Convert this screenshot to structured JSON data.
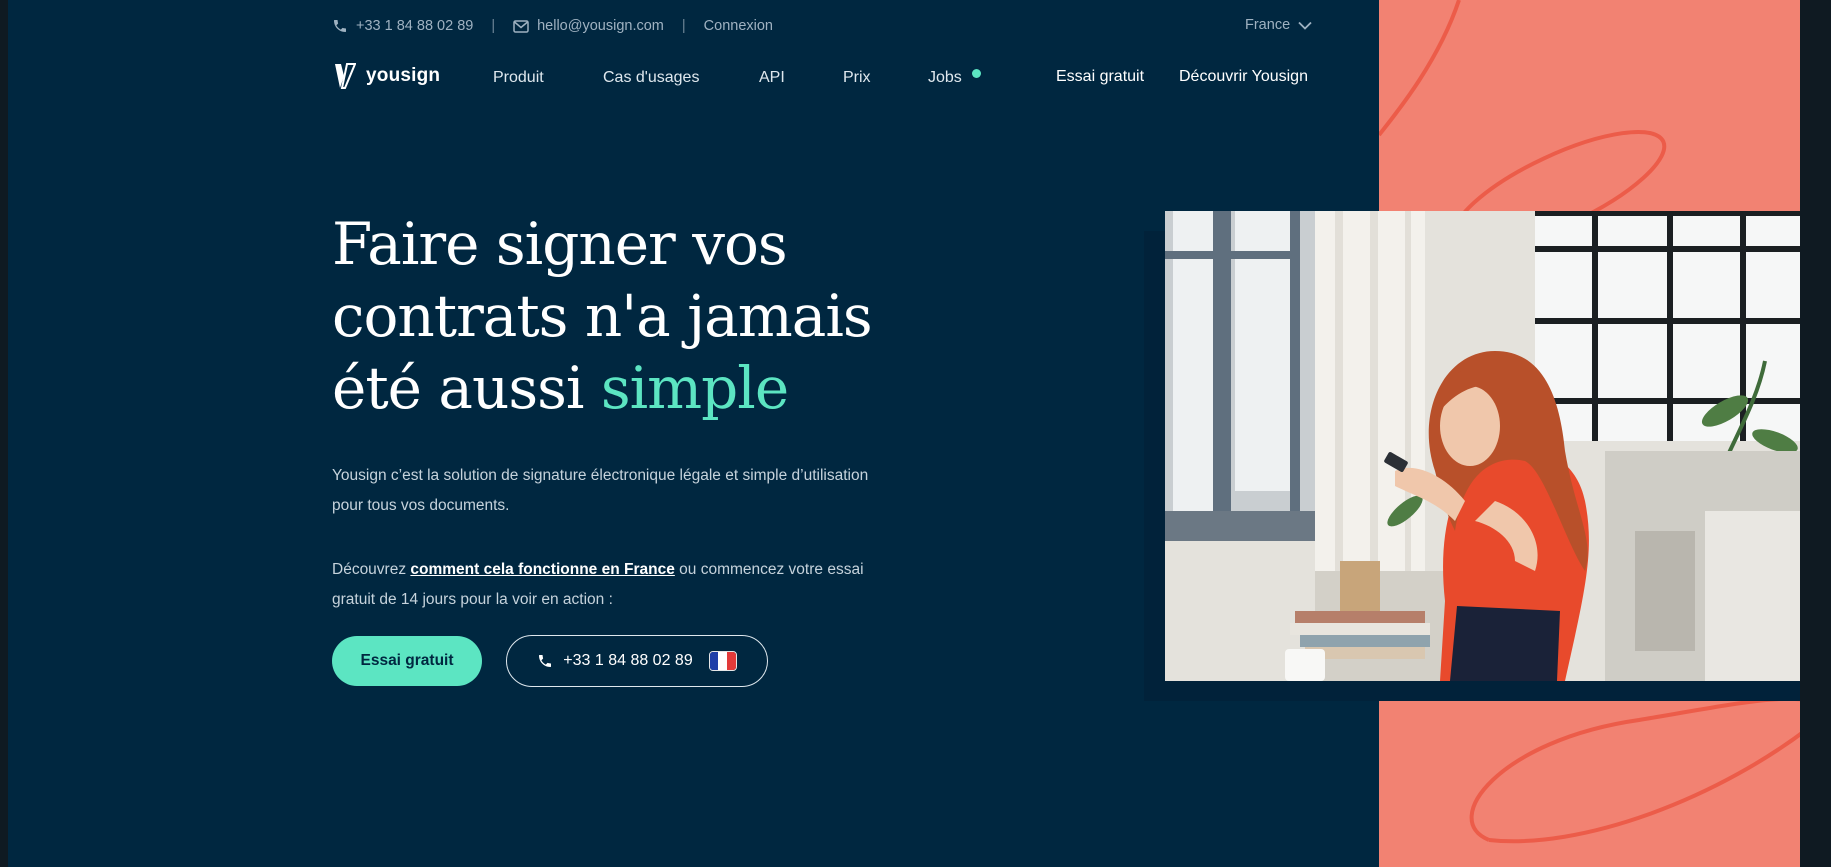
{
  "topbar": {
    "phone": "+33 1 84 88 02 89",
    "email": "hello@yousign.com",
    "login": "Connexion",
    "separator": "|",
    "country": "France"
  },
  "brand": {
    "name": "yousign"
  },
  "nav": {
    "items": [
      "Produit",
      "Cas d'usages",
      "API",
      "Prix",
      "Jobs"
    ],
    "cta_trial": "Essai gratuit",
    "cta_discover": "Découvrir Yousign"
  },
  "hero": {
    "headline_line1": "Faire signer vos",
    "headline_line2": "contrats n'a jamais",
    "headline_line3_prefix": "été aussi ",
    "headline_accent": "simple",
    "description": "Yousign c’est la solution de signature électronique légale et simple d’utilisation pour tous vos documents.",
    "discover_prefix": "Découvrez ",
    "discover_link": "comment cela fonctionne en France",
    "discover_suffix": " ou commencez votre essai gratuit de 14 jours pour la voir en action :",
    "primary_button": "Essai gratuit",
    "phone_button": "+33 1 84 88 02 89"
  },
  "colors": {
    "background": "#002740",
    "accent": "#5ce5c2",
    "salmon": "#f28272",
    "salmon_line": "#ec5c49"
  },
  "icons": [
    "phone-icon",
    "mail-icon",
    "chevron-down-icon",
    "yousign-logo-icon",
    "french-flag-icon"
  ]
}
